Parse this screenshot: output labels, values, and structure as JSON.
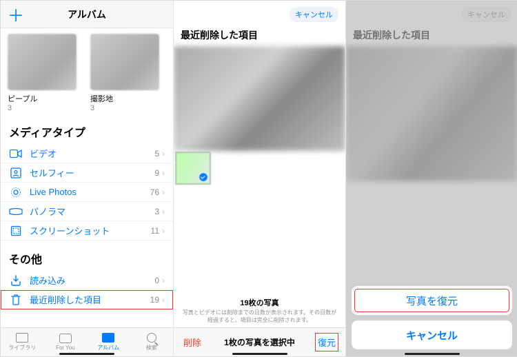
{
  "pane1": {
    "add_label": "＋",
    "title": "アルバム",
    "thumbs": [
      {
        "label": "ピープル",
        "count": "3"
      },
      {
        "label": "撮影地",
        "count": "3"
      }
    ],
    "media_section": "メディアタイプ",
    "media_rows": [
      {
        "icon": "video-icon",
        "label": "ビデオ",
        "count": "5"
      },
      {
        "icon": "selfie-icon",
        "label": "セルフィー",
        "count": "9"
      },
      {
        "icon": "live-photos-icon",
        "label": "Live Photos",
        "count": "76"
      },
      {
        "icon": "panorama-icon",
        "label": "パノラマ",
        "count": "3"
      },
      {
        "icon": "screenshot-icon",
        "label": "スクリーンショット",
        "count": "11"
      }
    ],
    "other_section": "その他",
    "other_rows": [
      {
        "icon": "import-icon",
        "label": "読み込み",
        "count": "0"
      },
      {
        "icon": "trash-icon",
        "label": "最近削除した項目",
        "count": "19"
      }
    ],
    "tabs": [
      {
        "label": "ライブラリ"
      },
      {
        "label": "For You"
      },
      {
        "label": "アルバム"
      },
      {
        "label": "検索"
      }
    ]
  },
  "pane2": {
    "cancel": "キャンセル",
    "title": "最近削除した項目",
    "info_count": "19枚の写真",
    "info_note": "写真とビデオには削除までの日数が表示されます。その日数が経過すると、項目は完全に削除されます。",
    "delete": "削除",
    "selected": "1枚の写真を選択中",
    "recover": "復元"
  },
  "pane3": {
    "cancel_top": "キャンセル",
    "title": "最近削除した項目",
    "recover_btn": "写真を復元",
    "cancel_btn": "キャンセル"
  },
  "chevron": "›"
}
